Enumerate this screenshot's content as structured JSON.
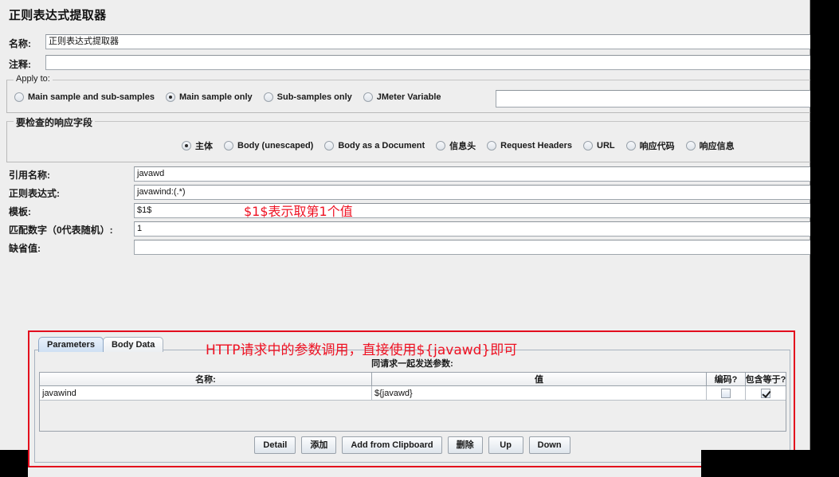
{
  "title": "正则表达式提取器",
  "form": {
    "name_label": "名称:",
    "name_value": "正则表达式提取器",
    "comment_label": "注释:",
    "comment_value": ""
  },
  "apply_to": {
    "group_title": "Apply to:",
    "options": [
      {
        "label": "Main sample and sub-samples",
        "selected": false
      },
      {
        "label": "Main sample only",
        "selected": true
      },
      {
        "label": "Sub-samples only",
        "selected": false
      },
      {
        "label": "JMeter Variable",
        "selected": false
      }
    ],
    "variable_value": ""
  },
  "response_field": {
    "group_title": "要检查的响应字段",
    "options": [
      {
        "label": "主体",
        "selected": true
      },
      {
        "label": "Body (unescaped)",
        "selected": false
      },
      {
        "label": "Body as a Document",
        "selected": false
      },
      {
        "label": "信息头",
        "selected": false
      },
      {
        "label": "Request Headers",
        "selected": false
      },
      {
        "label": "URL",
        "selected": false
      },
      {
        "label": "响应代码",
        "selected": false
      },
      {
        "label": "响应信息",
        "selected": false
      }
    ]
  },
  "extractor": {
    "reference_name_label": "引用名称:",
    "reference_name_value": "javawd",
    "regex_label": "正则表达式:",
    "regex_value": "javawind:(.*)",
    "template_label": "模板:",
    "template_value": "$1$",
    "match_no_label": "匹配数字（0代表随机）:",
    "match_no_value": "1",
    "default_label": "缺省值:",
    "default_value": ""
  },
  "annotations": {
    "template_note": "$1$表示取第1个值",
    "http_note": "HTTP请求中的参数调用，直接使用${javawd}即可",
    "color": "#ee1122"
  },
  "http_panel": {
    "tabs": [
      {
        "label": "Parameters",
        "active": true
      },
      {
        "label": "Body Data",
        "active": false
      }
    ],
    "table_caption": "同请求一起发送参数:",
    "columns": [
      "名称:",
      "值",
      "编码?",
      "包含等于?"
    ],
    "rows": [
      {
        "name": "javawind",
        "value": "${javawd}",
        "encode": false,
        "include_equals": true
      }
    ],
    "buttons": [
      "Detail",
      "添加",
      "Add from Clipboard",
      "删除",
      "Up",
      "Down"
    ]
  }
}
